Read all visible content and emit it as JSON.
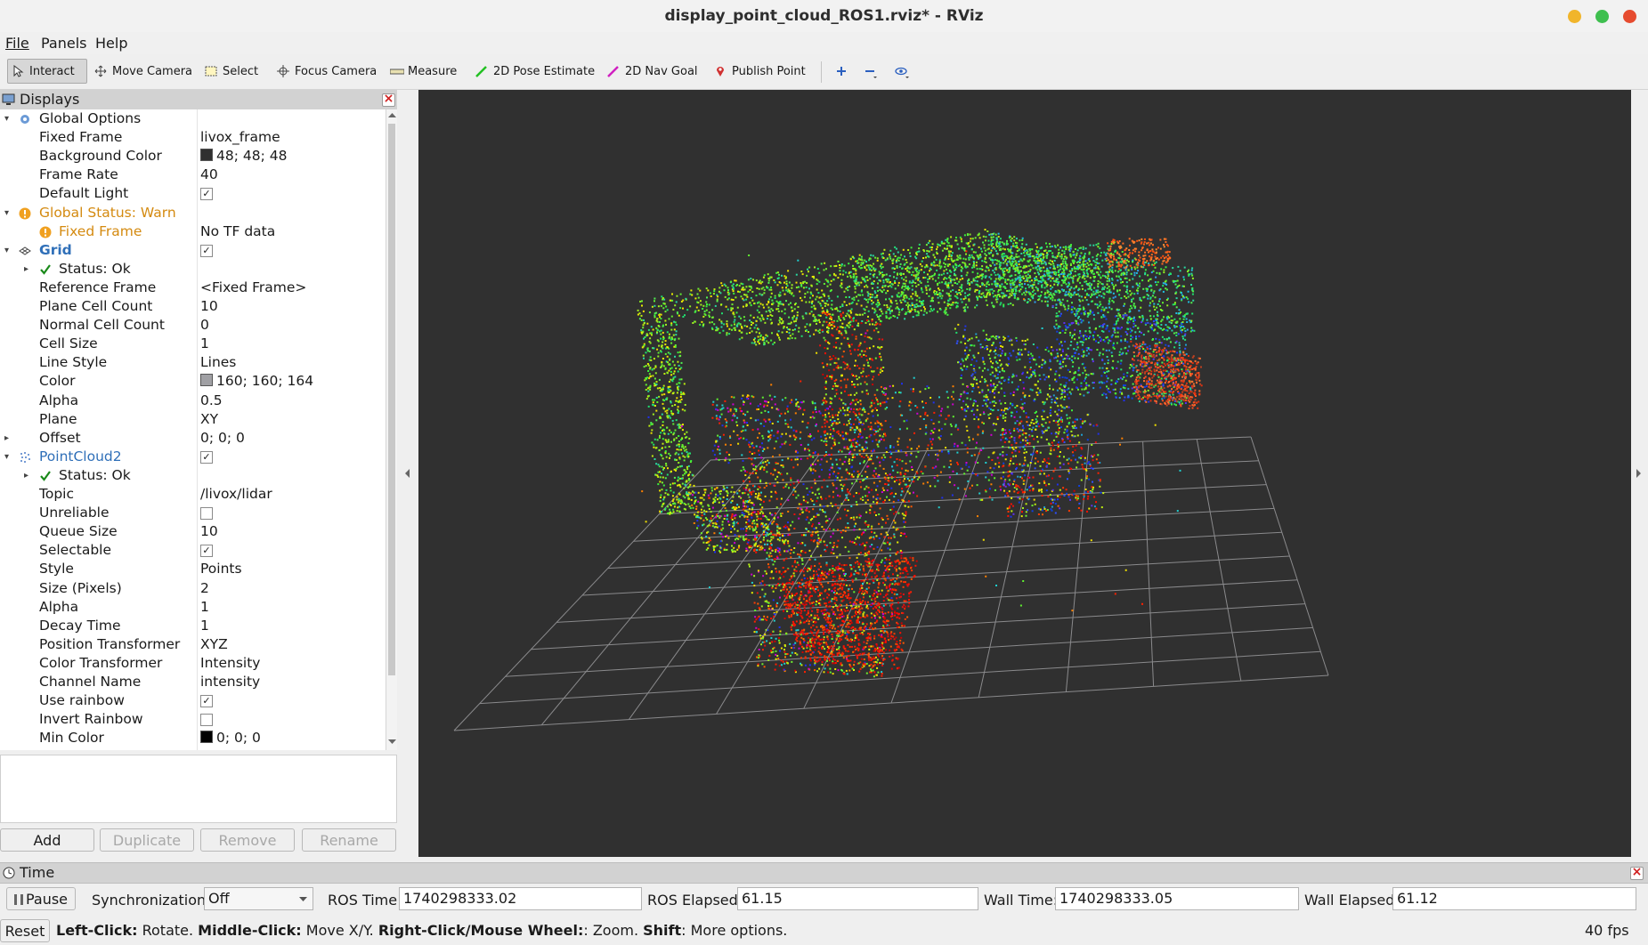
{
  "window": {
    "title": "display_point_cloud_ROS1.rviz* - RViz",
    "colors": {
      "minimize": "#f1b52b",
      "maximize": "#3fbf4f",
      "close": "#e64b2f"
    }
  },
  "menu": [
    "File",
    "Panels",
    "Help"
  ],
  "toolbar": {
    "tools": [
      {
        "label": "Interact",
        "icon": "cursor-icon",
        "active": true
      },
      {
        "label": "Move Camera",
        "icon": "move-icon"
      },
      {
        "label": "Select",
        "icon": "select-box-icon"
      },
      {
        "label": "Focus Camera",
        "icon": "crosshair-icon"
      },
      {
        "label": "Measure",
        "icon": "ruler-icon"
      },
      {
        "label": "2D Pose Estimate",
        "icon": "green-arrow-icon"
      },
      {
        "label": "2D Nav Goal",
        "icon": "magenta-arrow-icon"
      },
      {
        "label": "Publish Point",
        "icon": "map-pin-icon"
      }
    ]
  },
  "displays": {
    "title": "Displays",
    "rows": [
      {
        "label": "Global Options",
        "value": ""
      },
      {
        "label": "Fixed Frame",
        "value": "livox_frame"
      },
      {
        "label": "Background Color",
        "value": "48; 48; 48",
        "swatch": "#303030"
      },
      {
        "label": "Frame Rate",
        "value": "40"
      },
      {
        "label": "Default Light",
        "value": ""
      },
      {
        "label": "Global Status: Warn",
        "value": ""
      },
      {
        "label": "Fixed Frame",
        "value": "No TF data"
      },
      {
        "label": "Grid",
        "value": ""
      },
      {
        "label": "Status: Ok",
        "value": ""
      },
      {
        "label": "Reference Frame",
        "value": "<Fixed Frame>"
      },
      {
        "label": "Plane Cell Count",
        "value": "10"
      },
      {
        "label": "Normal Cell Count",
        "value": "0"
      },
      {
        "label": "Cell Size",
        "value": "1"
      },
      {
        "label": "Line Style",
        "value": "Lines"
      },
      {
        "label": "Color",
        "value": "160; 160; 164",
        "swatch": "#a0a0a4"
      },
      {
        "label": "Alpha",
        "value": "0.5"
      },
      {
        "label": "Plane",
        "value": "XY"
      },
      {
        "label": "Offset",
        "value": "0; 0; 0"
      },
      {
        "label": "PointCloud2",
        "value": ""
      },
      {
        "label": "Status: Ok",
        "value": ""
      },
      {
        "label": "Topic",
        "value": "/livox/lidar"
      },
      {
        "label": "Unreliable",
        "value": ""
      },
      {
        "label": "Queue Size",
        "value": "10"
      },
      {
        "label": "Selectable",
        "value": ""
      },
      {
        "label": "Style",
        "value": "Points"
      },
      {
        "label": "Size (Pixels)",
        "value": "2"
      },
      {
        "label": "Alpha",
        "value": "1"
      },
      {
        "label": "Decay Time",
        "value": "1"
      },
      {
        "label": "Position Transformer",
        "value": "XYZ"
      },
      {
        "label": "Color Transformer",
        "value": "Intensity"
      },
      {
        "label": "Channel Name",
        "value": "intensity"
      },
      {
        "label": "Use rainbow",
        "value": ""
      },
      {
        "label": "Invert Rainbow",
        "value": ""
      },
      {
        "label": "Min Color",
        "value": "0; 0; 0",
        "swatch": "#000000"
      }
    ],
    "buttons": {
      "add": "Add",
      "duplicate": "Duplicate",
      "remove": "Remove",
      "rename": "Rename"
    }
  },
  "time": {
    "title": "Time",
    "pause": "Pause",
    "sync_label": "Synchronization:",
    "sync_value": "Off",
    "ros_time_label": "ROS Time:",
    "ros_time": "1740298333.02",
    "ros_elapsed_label": "ROS Elapsed:",
    "ros_elapsed": "61.15",
    "wall_time_label": "Wall Time:",
    "wall_time": "1740298333.05",
    "wall_elapsed_label": "Wall Elapsed:",
    "wall_elapsed": "61.12"
  },
  "status": {
    "reset": "Reset",
    "hint_b1": "Left-Click:",
    "hint_t1": " Rotate. ",
    "hint_b2": "Middle-Click:",
    "hint_t2": " Move X/Y. ",
    "hint_b3": "Right-Click/Mouse Wheel:",
    "hint_t3": ": Zoom. ",
    "hint_b4": "Shift",
    "hint_t4": ": More options.",
    "fps": "40 fps"
  }
}
